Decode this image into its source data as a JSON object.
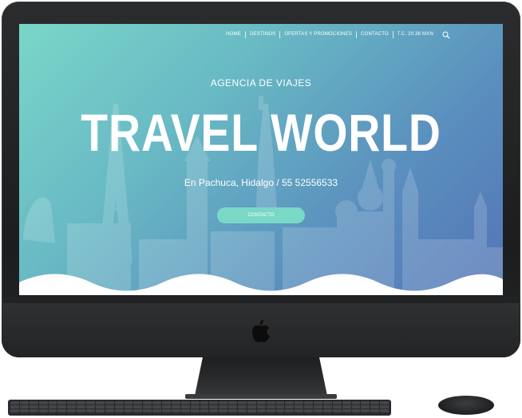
{
  "nav": {
    "items": [
      "HOME",
      "DESTINOS",
      "OFERTAS Y PROMOCIONES",
      "CONTACTO",
      "T.C. 20.38 MXN"
    ],
    "search_icon": "search-icon"
  },
  "hero": {
    "subtitle": "AGENCIA DE VIAJES",
    "title": "TRAVEL WORLD",
    "location": "En Pachuca, Hidalgo / 55 52556533",
    "cta_label": "CONTACTO"
  },
  "colors": {
    "gradient_start": "#7ad6c8",
    "gradient_end": "#5374b6",
    "cta": "#7ad8c7",
    "device": "#1c1d1f"
  },
  "device": {
    "logo_icon": "apple-logo-icon"
  }
}
